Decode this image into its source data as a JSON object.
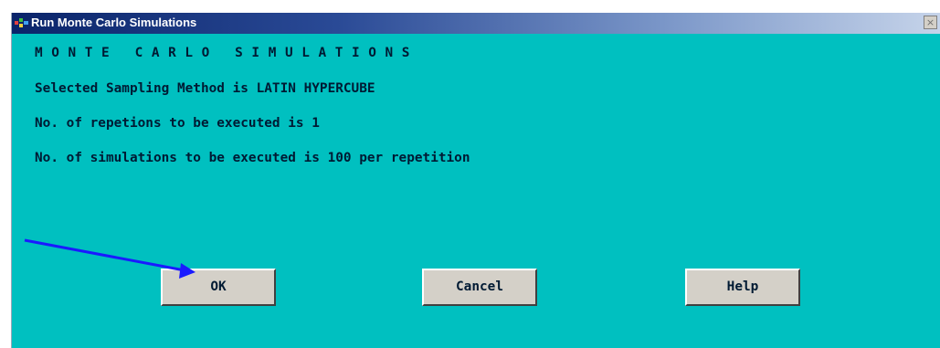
{
  "window": {
    "title": "Run Monte Carlo Simulations",
    "close_glyph": "×"
  },
  "content": {
    "heading": "MONTE CARLO SIMULATIONS",
    "line1": "Selected Sampling Method is LATIN HYPERCUBE",
    "line2": "No. of repetions to be executed is 1",
    "line3": "No. of simulations to be executed is 100 per repetition"
  },
  "buttons": {
    "ok": "OK",
    "cancel": "Cancel",
    "help": "Help"
  },
  "colors": {
    "background": "#00c0c0",
    "text": "#001a33",
    "annotation_arrow": "#1a1aff"
  },
  "icons": {
    "window_icon": "app-icon",
    "close": "close-icon",
    "annotation": "annotation-arrow"
  }
}
